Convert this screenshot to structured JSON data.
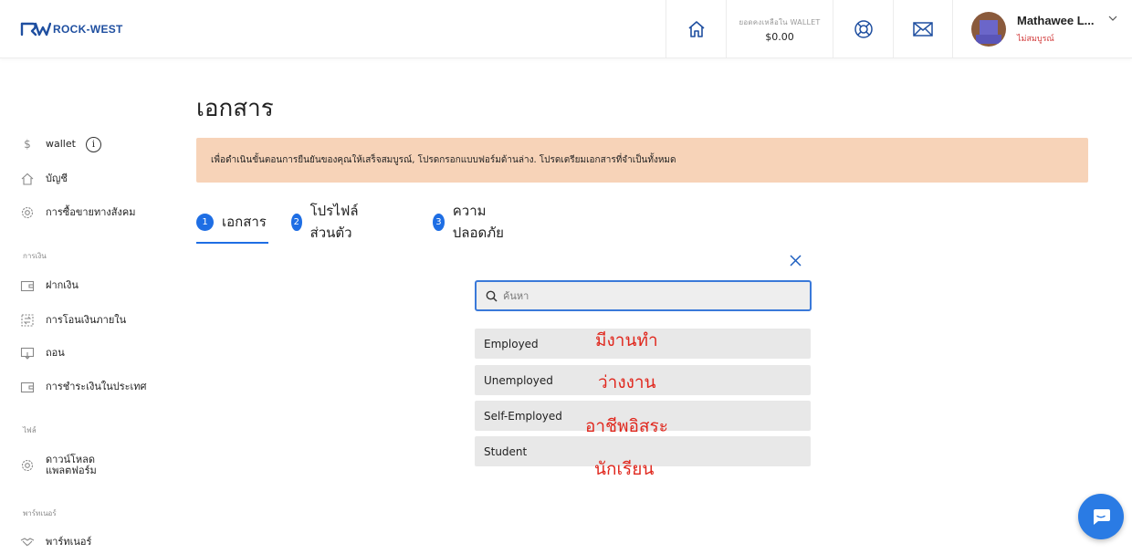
{
  "header": {
    "logo_text": "ROCK-WEST",
    "wallet_label": "ยอดคงเหลือใน WALLET",
    "wallet_amount": "$0.00",
    "user_name": "Mathawee L...",
    "user_status": "ไม่สมบูรณ์",
    "icons": [
      "home-icon",
      "support-icon",
      "mail-icon",
      "chevron-down-icon"
    ]
  },
  "sidebar": {
    "wallet_label": "wallet",
    "account_label": "บัญชี",
    "social_trading_label": "การซื้อขายทางสังคม",
    "finance_heading": "การเงิน",
    "deposit_label": "ฝากเงิน",
    "internal_transfer_label": "การโอนเงินภายใน",
    "withdraw_label": "ถอน",
    "domestic_payment_label": "การชำระเงินในประเทศ",
    "files_heading": "ไฟล์",
    "download_platform_label": "ดาวน์โหลด\nแพลตฟอร์ม",
    "partner_heading": "พาร์ทเนอร์",
    "partner_label": "พาร์ทเนอร์"
  },
  "main": {
    "title": "เอกสาร",
    "notice": "เพื่อดำเนินขั้นตอนการยืนยันของคุณให้เสร็จสมบูรณ์, โปรดกรอกแบบฟอร์มด้านล่าง. โปรดเตรียมเอกสารที่จำเป็นทั้งหมด",
    "steps": [
      {
        "num": "1",
        "label": "เอกสาร"
      },
      {
        "num": "2",
        "label": "โปรไฟล์ส่วนตัว"
      },
      {
        "num": "3",
        "label": "ความปลอดภัย"
      }
    ],
    "search": {
      "placeholder": "ค้นหา",
      "value": ""
    },
    "options": [
      "Employed",
      "Unemployed",
      "Self-Employed",
      "Student"
    ],
    "annotations": [
      "มีงานทำ",
      "ว่างงาน",
      "อาชีพอิสระ",
      "นักเรียน"
    ]
  },
  "colors": {
    "brand": "#1f4fa0",
    "accent": "#1e6ee4",
    "notice_bg": "#f7d3b8",
    "status_red": "#d23b3b",
    "annotation_red": "#e0271d"
  }
}
